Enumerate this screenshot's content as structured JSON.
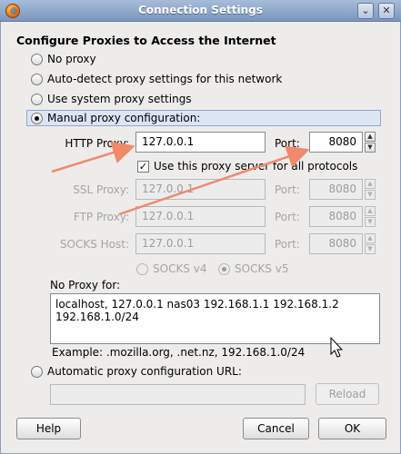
{
  "window": {
    "title": "Connection Settings"
  },
  "heading": "Configure Proxies to Access the Internet",
  "options": {
    "no_proxy": "No proxy",
    "auto_detect": "Auto-detect proxy settings for this network",
    "system": "Use system proxy settings",
    "manual": "Manual proxy configuration:",
    "auto_url": "Automatic proxy configuration URL:"
  },
  "http": {
    "label": "HTTP Proxy:",
    "value": "127.0.0.1",
    "port_label": "Port:",
    "port": "8080"
  },
  "use_for_all": "Use this proxy server for all protocols",
  "ssl": {
    "label": "SSL Proxy:",
    "value": "127.0.0.1",
    "port_label": "Port:",
    "port": "8080"
  },
  "ftp": {
    "label": "FTP Proxy:",
    "value": "127.0.0.1",
    "port_label": "Port:",
    "port": "8080"
  },
  "socks": {
    "label": "SOCKS Host:",
    "value": "127.0.0.1",
    "port_label": "Port:",
    "port": "8080",
    "v4": "SOCKS v4",
    "v5": "SOCKS v5"
  },
  "no_proxy_for": {
    "label": "No Proxy for:",
    "value": "localhost, 127.0.0.1 nas03 192.168.1.1 192.168.1.2 192.168.1.0/24",
    "example": "Example: .mozilla.org, .net.nz, 192.168.1.0/24"
  },
  "auto_url_value": "",
  "buttons": {
    "reload": "Reload",
    "help": "Help",
    "cancel": "Cancel",
    "ok": "OK"
  },
  "colors": {
    "annotation_arrow": "#f08a6a",
    "title_bar": "#7b97bf"
  },
  "icons": {
    "app": "firefox-icon",
    "minimize": "minimize-icon",
    "close": "close-icon"
  }
}
